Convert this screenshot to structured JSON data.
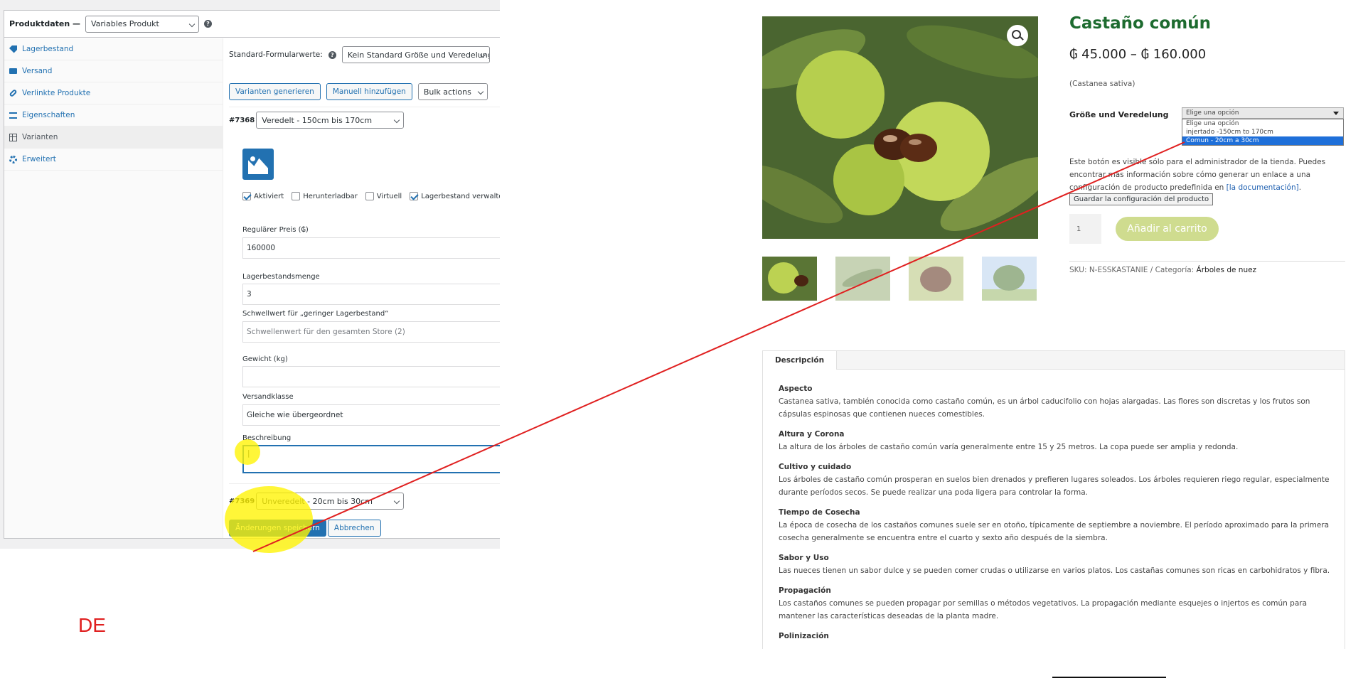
{
  "admin": {
    "header_label": "Produktdaten —",
    "product_type": "Variables Produkt",
    "help_glyph": "?",
    "tabs": [
      {
        "label": "Lagerbestand",
        "icon": "tag-icon"
      },
      {
        "label": "Versand",
        "icon": "truck-icon"
      },
      {
        "label": "Verlinkte Produkte",
        "icon": "link-icon"
      },
      {
        "label": "Eigenschaften",
        "icon": "list-icon"
      },
      {
        "label": "Varianten",
        "icon": "grid-icon"
      },
      {
        "label": "Erweitert",
        "icon": "gear-icon"
      }
    ],
    "defaults_label": "Standard-Formularwerte:",
    "defaults_value": "Kein Standard Größe und Veredelung...",
    "generate_button": "Varianten generieren",
    "add_manually_button": "Manuell hinzufügen",
    "bulk_actions": "Bulk actions",
    "variation1": {
      "id": "#7368",
      "value": "Veredelt - 150cm bis 170cm",
      "checkboxes": [
        {
          "label": "Aktiviert",
          "checked": true
        },
        {
          "label": "Herunterladbar",
          "checked": false
        },
        {
          "label": "Virtuell",
          "checked": false
        },
        {
          "label": "Lagerbestand verwalten?",
          "checked": true
        }
      ],
      "price_label": "Regulärer Preis (₲)",
      "price_value": "160000",
      "stock_label": "Lagerbestandsmenge",
      "stock_value": "3",
      "low_stock_label": "Schwellwert für „geringer Lagerbestand“",
      "low_stock_placeholder": "Schwellenwert für den gesamten Store (2)",
      "weight_label": "Gewicht (kg)",
      "weight_value": "",
      "shipping_label": "Versandklasse",
      "shipping_value": "Gleiche wie übergeordnet",
      "description_label": "Beschreibung",
      "description_value": "|"
    },
    "variation2": {
      "id": "#7369",
      "value": "Unveredelt - 20cm bis 30cm"
    },
    "save_button": "Änderungen speichern",
    "cancel_button": "Abbrechen"
  },
  "annotation_label": "DE",
  "colors": {
    "admin_blue": "#2271b1",
    "title_green": "#1d6b2f",
    "cart_button": "#cfdc8f",
    "highlight_yellow": "#fff300",
    "annotation_red": "#e02020"
  },
  "shop": {
    "title": "Castaño común",
    "price": "₲ 45.000 – ₲ 160.000",
    "latin_name": "(Castanea sativa)",
    "option_label": "Größe und Veredelung",
    "select_value": "Elige una opción",
    "select_options": [
      "Elige una opción",
      "injertado -150cm to 170cm",
      "Comun - 20cm a 30cm"
    ],
    "selected_option_index": 2,
    "admin_note": "Este botón es visible sólo para el administrador de la tienda. Puedes encontrar más información sobre cómo generar un enlace a una configuración de producto predefinida en ",
    "admin_note_link": "[la documentación]",
    "admin_note_end": ".",
    "save_config_button": "Guardar la configuración del producto",
    "quantity": "1",
    "add_to_cart": "Añadir al carrito",
    "sku_label": "SKU: N-ESSKASTANIE / Categoría: ",
    "category": "Árboles de nuez",
    "description_tab": "Descripción",
    "sections": [
      {
        "heading": "Aspecto",
        "text": "Castanea sativa, también conocida como castaño común, es un árbol caducifolio con hojas alargadas. Las flores son discretas y los frutos son cápsulas espinosas que contienen nueces comestibles."
      },
      {
        "heading": "Altura y Corona",
        "text": "La altura de los árboles de castaño común varía generalmente entre 15 y 25 metros. La copa puede ser amplia y redonda."
      },
      {
        "heading": "Cultivo y cuidado",
        "text": "Los árboles de castaño común prosperan en suelos bien drenados y prefieren lugares soleados. Los árboles requieren riego regular, especialmente durante períodos secos. Se puede realizar una poda ligera para controlar la forma."
      },
      {
        "heading": "Tiempo de Cosecha",
        "text": "La época de cosecha de los castaños comunes suele ser en otoño, típicamente de septiembre a noviembre. El período aproximado para la primera cosecha generalmente se encuentra entre el cuarto y sexto año después de la siembra."
      },
      {
        "heading": "Sabor y Uso",
        "text": "Las nueces tienen un sabor dulce y se pueden comer crudas o utilizarse en varios platos. Los castañas comunes son ricas en carbohidratos y fibra."
      },
      {
        "heading": "Propagación",
        "text": "Los castaños comunes se pueden propagar por semillas o métodos vegetativos. La propagación mediante esquejes o injertos es común para mantener las características deseadas de la planta madre."
      },
      {
        "heading": "Polinización",
        "text": ""
      }
    ]
  }
}
